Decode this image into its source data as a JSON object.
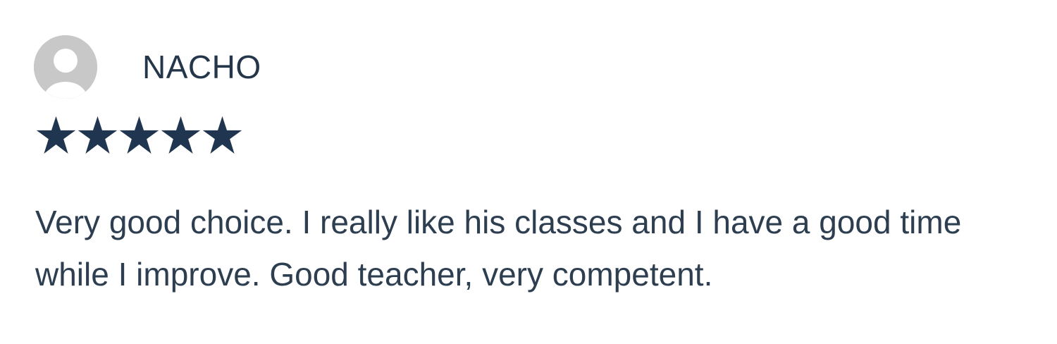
{
  "review": {
    "reviewer_name": "NACHO",
    "avatar_icon": "default-user-avatar-icon",
    "rating": 5,
    "rating_max": 5,
    "star_color": "#1f3550",
    "text": "Very good choice. I really like his classes and I have a good time while I improve. Good teacher, very competent."
  }
}
